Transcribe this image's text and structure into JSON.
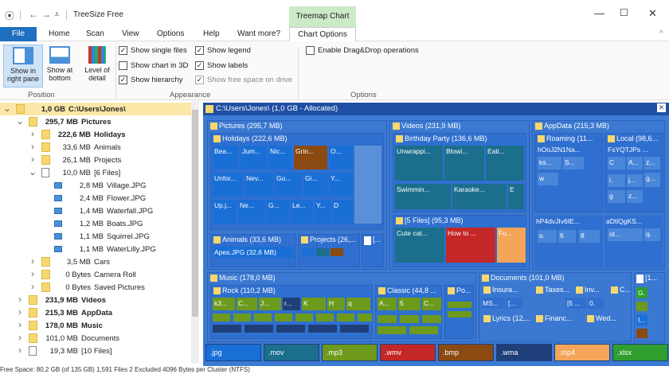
{
  "app": {
    "title": "TreeSize Free",
    "context_tab": "Treemap Chart"
  },
  "tabs": [
    "File",
    "Home",
    "Scan",
    "View",
    "Options",
    "Help",
    "Want more?",
    "Chart Options"
  ],
  "ribbon": {
    "show_in_right_pane": "Show in right pane",
    "show_at_bottom": "Show at bottom",
    "level_of_detail": "Level of detail",
    "cb_single_files": "Show single files",
    "cb_chart_3d": "Show chart in 3D",
    "cb_hierarchy": "Show hierarchy",
    "cb_legend": "Show legend",
    "cb_labels": "Show labels",
    "cb_free_space": "Show free space on drive",
    "cb_dragdrop": "Enable Drag&Drop operations",
    "grp_position": "Position",
    "grp_appearance": "Appearance",
    "grp_options": "Options"
  },
  "tree": [
    {
      "size": "1,0 GB",
      "name": "C:\\Users\\Jones\\"
    },
    {
      "size": "295,7 MB",
      "name": "Pictures"
    },
    {
      "size": "222,6 MB",
      "name": "Holidays"
    },
    {
      "size": "33,6 MB",
      "name": "Animals"
    },
    {
      "size": "26,1 MB",
      "name": "Projects"
    },
    {
      "size": "10,0 MB",
      "name": "[6 Files]"
    },
    {
      "size": "2,8 MB",
      "name": "Village.JPG"
    },
    {
      "size": "2,4 MB",
      "name": "Flower.JPG"
    },
    {
      "size": "1,4 MB",
      "name": "Waterfall.JPG"
    },
    {
      "size": "1,2 MB",
      "name": "Boats.JPG"
    },
    {
      "size": "1,1 MB",
      "name": "Squirrel.JPG"
    },
    {
      "size": "1,1 MB",
      "name": "WaterLilly.JPG"
    },
    {
      "size": "3,5 MB",
      "name": "Cars"
    },
    {
      "size": "0 Bytes",
      "name": "Camera Roll"
    },
    {
      "size": "0 Bytes",
      "name": "Saved Pictures"
    },
    {
      "size": "231,9 MB",
      "name": "Videos"
    },
    {
      "size": "215,3 MB",
      "name": "AppData"
    },
    {
      "size": "178,0 MB",
      "name": "Music"
    },
    {
      "size": "101,0 MB",
      "name": "Documents"
    },
    {
      "size": "19,3 MB",
      "name": "[10 Files]"
    }
  ],
  "treemap": {
    "header": "C:\\Users\\Jones\\ (1,0 GB - Allocated)",
    "pictures": "Pictures (295,7 MB)",
    "holidays": "Holidays (222,6 MB)",
    "videos": "Videos (231,9 MB)",
    "birthday": "Birthday Party (136,6 MB)",
    "vfiles": "[5 Files] (95,3 MB)",
    "appdata": "AppData (215,3 MB)",
    "roaming": "Roaming (11...",
    "local": "Local (98,6...",
    "animals": "Animals (33,6 MB)",
    "projects": "Projects (26,...",
    "apesjpg": "Apes.JPG (32,6 MB)",
    "music": "Music (178,0 MB)",
    "rock": "Rock (110,2 MB)",
    "classic": "Classic (44,8 ...",
    "po": "Po...",
    "documents": "Documents (101,0 MB)",
    "insura": "Insura...",
    "taxes": "Taxes...",
    "inv": "Inv...",
    "c": "C...",
    "lyrics": "Lyrics (12,...",
    "financ": "Financ...",
    "wed": "Wed...",
    "one": "[1...",
    "h_leaves": [
      "Bea...",
      "Jum...",
      "Nic...",
      "Grin...",
      "O...",
      "Unfor...",
      "Nev...",
      "Go...",
      "Gi...",
      "Y...",
      "Up.j...",
      "Ne...",
      "G...",
      "Le...",
      "Y...",
      "D"
    ],
    "b_leaves": [
      "Unwrappi...",
      "Blowi...",
      "Eati...",
      "Swimmin...",
      "Karaoke...",
      "E"
    ],
    "v_leaves": [
      "Cute cat...",
      "How to ...",
      "Fu..."
    ],
    "a_leaves": [
      "hOoJ2N1Na...",
      "FsYQTJPs ...",
      "ks...",
      "S...",
      "C",
      "A...",
      "z...",
      "w",
      "i.",
      "j...",
      "g...",
      "g",
      "z...",
      "hP4dvJIv6IE...",
      "aDtlQgKS...",
      "o.",
      "6",
      "8",
      "ol...",
      "q."
    ],
    "r_leaves": [
      "k3...",
      "C...",
      "J...",
      "r...",
      "K",
      "H",
      "q",
      "A...",
      "5",
      "1...",
      "C..."
    ],
    "d_leaves": [
      "MS...",
      "[...",
      "[5 ...",
      "0.",
      "G.",
      "I..."
    ]
  },
  "legend": [
    {
      "ext": ".jpg",
      "color": "#1a6fd6"
    },
    {
      "ext": ".mov",
      "color": "#1b6e8c"
    },
    {
      "ext": ".mp3",
      "color": "#6d9a1c"
    },
    {
      "ext": ".wmv",
      "color": "#c42727"
    },
    {
      "ext": ".bmp",
      "color": "#8a4a12"
    },
    {
      "ext": ".wma",
      "color": "#1f3f7a"
    },
    {
      "ext": ".mp4",
      "color": "#f4a55a"
    },
    {
      "ext": ".xlsx",
      "color": "#2f9e2f"
    }
  ],
  "status": "Free Space: 80,2 GB (of 135 GB)   1,591 Files   2 Excluded   4096 Bytes per Cluster (NTFS)"
}
